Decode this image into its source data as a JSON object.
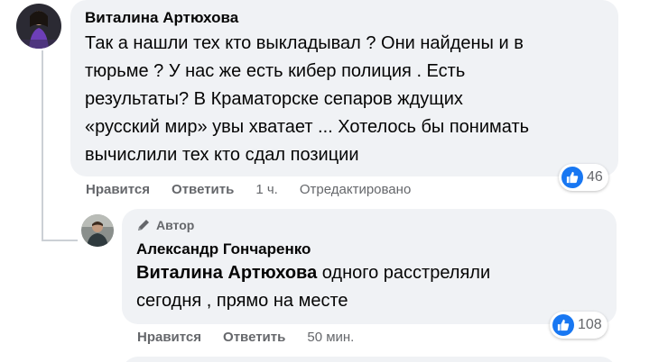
{
  "comment1": {
    "author": "Виталина Артюхова",
    "lines": [
      "Так а нашли тех кто выкладывал ? Они найдены и в",
      "тюрьме ? У нас же есть кибер полиция . Есть",
      "результаты? В Краматорске сепаров ждущих",
      "«русский мир» увы хватает ... Хотелось бы понимать",
      "вычислили тех кто сдал позиции"
    ],
    "actions": {
      "like": "Нравится",
      "reply": "Ответить",
      "time": "1 ч.",
      "edited": "Отредактировано"
    },
    "reaction_icon": "like-icon",
    "reaction_count": "46"
  },
  "reply1": {
    "badge_icon": "pencil-icon",
    "badge": "Автор",
    "author": "Александр Гончаренко",
    "mention": "Виталина Артюхова",
    "line1_rest": " одного расстреляли",
    "line2": "сегодня , прямо на месте",
    "actions": {
      "like": "Нравится",
      "reply": "Ответить",
      "time": "50 мин."
    },
    "reaction_icon": "like-icon",
    "reaction_count": "108"
  },
  "colors": {
    "bubble": "#f0f2f5",
    "like_blue": "#1877f2",
    "meta_text": "#65676b"
  }
}
